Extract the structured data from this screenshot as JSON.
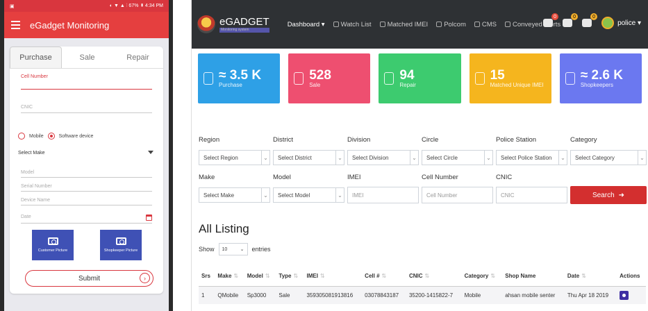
{
  "phone": {
    "status_left": "▣",
    "status_right": "◐ ▼ ▲ ⫶ 67% ▮ 4:34 PM",
    "app_title": "eGadget Monitoring",
    "tabs": [
      "Purchase",
      "Sale",
      "Repair"
    ],
    "cell_number_label": "Cell Number",
    "cnic_placeholder": "CNIC",
    "radio_mobile": "Mobile",
    "radio_software": "Software device",
    "select_make": "Select Make",
    "model_placeholder": "Model",
    "serial_placeholder": "Serial Number",
    "device_name_placeholder": "Device Name",
    "date_placeholder": "Date",
    "customer_picture": "Customer Picture",
    "shopkeeper_picture": "Shopkeeper Picture",
    "submit": "Submit"
  },
  "web": {
    "brand": "eGADGET",
    "brand_sub": "Monitoring system",
    "nav": [
      "Dashboard ▾",
      "Watch List",
      "Matched IMEI",
      "Polcom",
      "CMS",
      "Conveyed Alerts"
    ],
    "badges": [
      "0",
      "0",
      "0"
    ],
    "user": "police ▾",
    "stats": [
      {
        "value": "≈ 3.5 K",
        "label": "Purchase",
        "color": "#2ea0e6"
      },
      {
        "value": "528",
        "label": "Sale",
        "color": "#ee4f70"
      },
      {
        "value": "94",
        "label": "Repair",
        "color": "#3dcb6f"
      },
      {
        "value": "15",
        "label": "Matched Unique IMEI",
        "color": "#f5b51e"
      },
      {
        "value": "≈ 2.6 K",
        "label": "Shopkeepers",
        "color": "#6b78f0"
      }
    ],
    "filters": {
      "region_label": "Region",
      "region_value": "Select Region",
      "district_label": "District",
      "district_value": "Select District",
      "division_label": "Division",
      "division_value": "Select Division",
      "circle_label": "Circle",
      "circle_value": "Select Circle",
      "ps_label": "Police Station",
      "ps_value": "Select Police Station",
      "category_label": "Category",
      "category_value": "Select Category",
      "make_label": "Make",
      "make_value": "Select Make",
      "model_label": "Model",
      "model_value": "Select Model",
      "imei_label": "IMEI",
      "imei_placeholder": "IMEI",
      "cell_label": "Cell Number",
      "cell_placeholder": "Cell Number",
      "cnic_label": "CNIC",
      "cnic_placeholder": "CNIC",
      "search": "Search"
    },
    "listing_title": "All Listing",
    "show_label": "Show",
    "entries_value": "10",
    "entries_label": "entries",
    "columns": [
      "Srs",
      "Make",
      "Model",
      "Type",
      "IMEI",
      "Cell #",
      "CNIC",
      "Category",
      "Shop Name",
      "Date",
      "Actions"
    ],
    "rows": [
      [
        "1",
        "QMobile",
        "Sp3000",
        "Sale",
        "359305081913816",
        "03078843187",
        "35200-1415822-7",
        "Mobile",
        "ahsan mobile senter",
        "Thu Apr 18 2019"
      ]
    ]
  }
}
